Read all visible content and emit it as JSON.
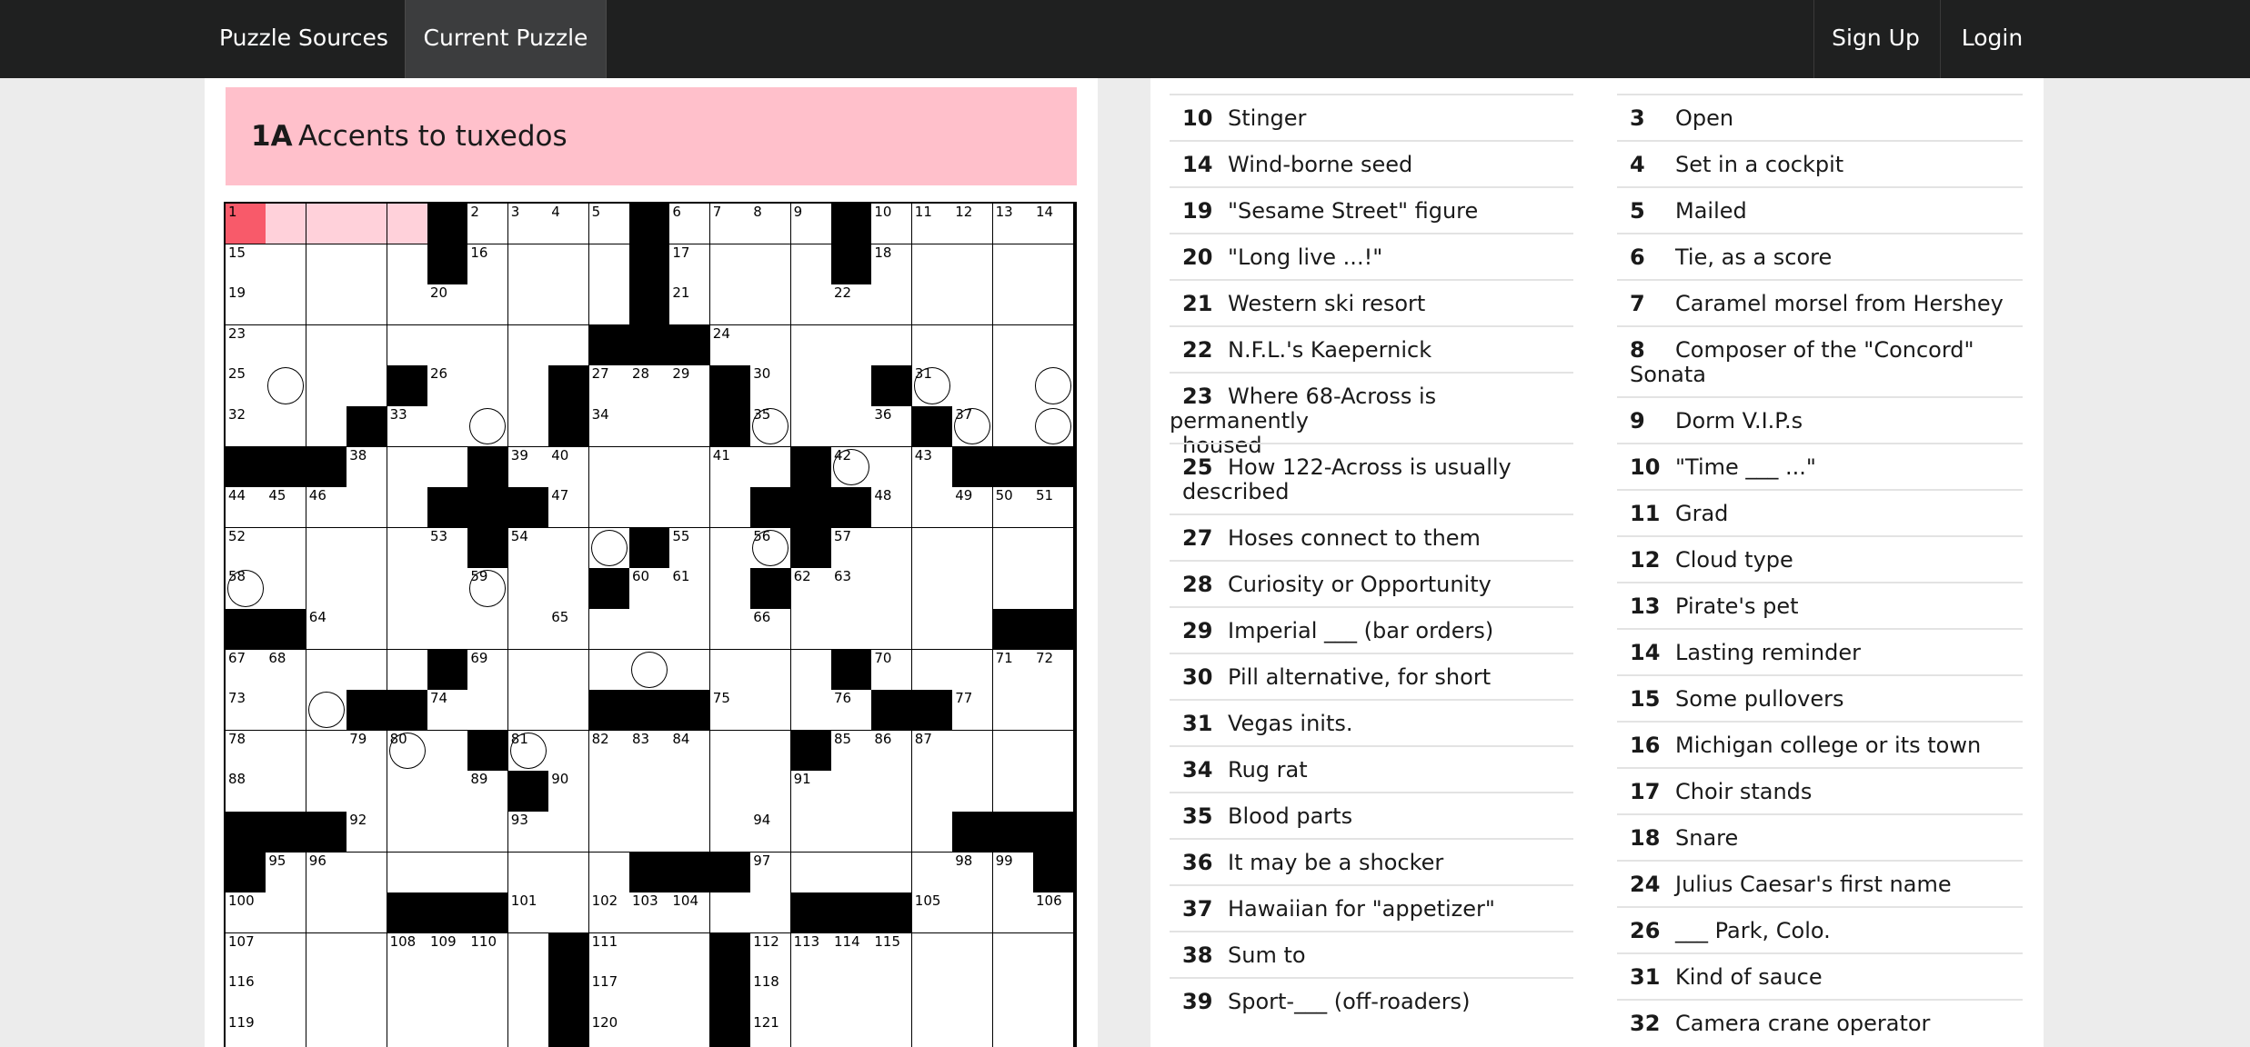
{
  "nav": {
    "sources": "Puzzle Sources",
    "current": "Current Puzzle",
    "signup": "Sign Up",
    "login": "Login"
  },
  "active_clue": {
    "number": "1A",
    "text": "Accents to tuxedos"
  },
  "grid": {
    "rows": [
      "1,0,0,0,0,#,1,1,1,1,#,1,1,1,1,#,1,1,1,1,1",
      "1,0,0,0,0,#,1,0,0,0,#,1,0,0,0,#,1,0,0,0,0",
      "1,0,0,0,0,1,0,0,0,0,#,1,0,0,0,1,0,0,0,0,0",
      "1,0,0,0,0,0,0,0,0,#,#,#,1,0,0,0,0,0,0,0,0",
      "1,0,0,0,#,1,0,0,#,1,1,1,#,1,0,0,#,1,0,0,0",
      "1,0,0,#,1,0,0,0,#,1,0,0,#,1,0,0,1,#,1,0,0",
      "#,#,#,1,0,0,#,1,1,0,0,0,1,0,#,1,0,1,#,#,#",
      "1,1,1,0,0,#,#,#,1,0,0,0,0,#,#,#,1,0,1,1,1",
      "1,0,0,0,0,1,#,1,0,0,#,1,0,1,#,1,0,0,0,0,0",
      "1,0,0,0,0,0,1,0,0,#,1,1,0,#,1,1,0,0,0,0,0",
      "#,#,1,0,0,0,0,0,1,0,0,0,0,1,0,0,0,0,0,#,#",
      "1,1,0,0,0,#,1,0,0,0,0,0,0,0,0,#,1,0,0,1,1",
      "1,0,0,#,#,1,0,0,0,#,#,#,1,0,0,1,#,#,1,0,0",
      "1,0,0,1,1,0,#,1,0,1,1,1,0,0,#,1,1,1,0,0,0",
      "1,0,0,0,0,0,1,#,1,0,0,0,0,0,1,0,0,0,0,0,0",
      "#,#,#,1,0,0,0,1,0,0,0,0,0,1,0,0,0,0,#,#,#",
      "#,1,1,0,0,0,0,0,0,0,#,#,#,1,0,0,0,0,1,1,#",
      "1,0,0,0,#,#,#,1,0,1,1,1,0,0,#,#,#,1,0,0,1",
      "1,0,0,0,1,1,1,0,#,1,0,0,#,1,1,1,1,0,0,0,0",
      "1,0,0,0,0,0,0,0,#,1,0,0,#,1,0,0,0,0,0,0,0",
      "1,0,0,0,0,0,0,0,#,1,0,0,#,1,0,0,0,0,0,0,0"
    ],
    "circles": [
      "4,1",
      "4,20",
      "5,6",
      "5,13",
      "5,18",
      "5,20",
      "6,15",
      "8,9",
      "8,13",
      "9,0",
      "9,6",
      "11,10",
      "12,2",
      "13,4",
      "13,7",
      "4,17"
    ],
    "selected": "0,0",
    "word": [
      "0,1",
      "0,2",
      "0,3",
      "0,4"
    ]
  },
  "across_clues": [
    {
      "num": "10",
      "text": "Stinger"
    },
    {
      "num": "14",
      "text": "Wind-borne seed"
    },
    {
      "num": "19",
      "text": "\"Sesame Street\" figure"
    },
    {
      "num": "20",
      "text": "\"Long live ...!\""
    },
    {
      "num": "21",
      "text": "Western ski resort"
    },
    {
      "num": "22",
      "text": "N.F.L.'s Kaepernick"
    },
    {
      "num": "23",
      "text": "Where 68-Across is permanently",
      "text2": "housed"
    },
    {
      "num": "25",
      "text": "How 122-Across is usually",
      "text2": "described"
    },
    {
      "num": "27",
      "text": "Hoses connect to them"
    },
    {
      "num": "28",
      "text": "Curiosity or Opportunity"
    },
    {
      "num": "29",
      "text": "Imperial ___ (bar orders)"
    },
    {
      "num": "30",
      "text": "Pill alternative, for short"
    },
    {
      "num": "31",
      "text": "Vegas inits."
    },
    {
      "num": "34",
      "text": "Rug rat"
    },
    {
      "num": "35",
      "text": "Blood parts"
    },
    {
      "num": "36",
      "text": "It may be a shocker"
    },
    {
      "num": "37",
      "text": "Hawaiian for \"appetizer\""
    },
    {
      "num": "38",
      "text": "Sum to"
    },
    {
      "num": "39",
      "text": "Sport-___ (off-roaders)"
    }
  ],
  "down_clues": [
    {
      "num": "3",
      "text": "Open"
    },
    {
      "num": "4",
      "text": "Set in a cockpit"
    },
    {
      "num": "5",
      "text": "Mailed"
    },
    {
      "num": "6",
      "text": "Tie, as a score"
    },
    {
      "num": "7",
      "text": "Caramel morsel from Hershey"
    },
    {
      "num": "8",
      "text": "Composer of the \"Concord\"",
      "text2": "Sonata"
    },
    {
      "num": "9",
      "text": "Dorm V.I.P.s"
    },
    {
      "num": "10",
      "text": "\"Time ___ ...\""
    },
    {
      "num": "11",
      "text": "Grad"
    },
    {
      "num": "12",
      "text": "Cloud type"
    },
    {
      "num": "13",
      "text": "Pirate's pet"
    },
    {
      "num": "14",
      "text": "Lasting reminder"
    },
    {
      "num": "15",
      "text": "Some pullovers"
    },
    {
      "num": "16",
      "text": "Michigan college or its town"
    },
    {
      "num": "17",
      "text": "Choir stands"
    },
    {
      "num": "18",
      "text": "Snare"
    },
    {
      "num": "24",
      "text": "Julius Caesar's first name"
    },
    {
      "num": "26",
      "text": "___ Park, Colo."
    },
    {
      "num": "31",
      "text": "Kind of sauce"
    },
    {
      "num": "32",
      "text": "Camera crane operator"
    }
  ]
}
